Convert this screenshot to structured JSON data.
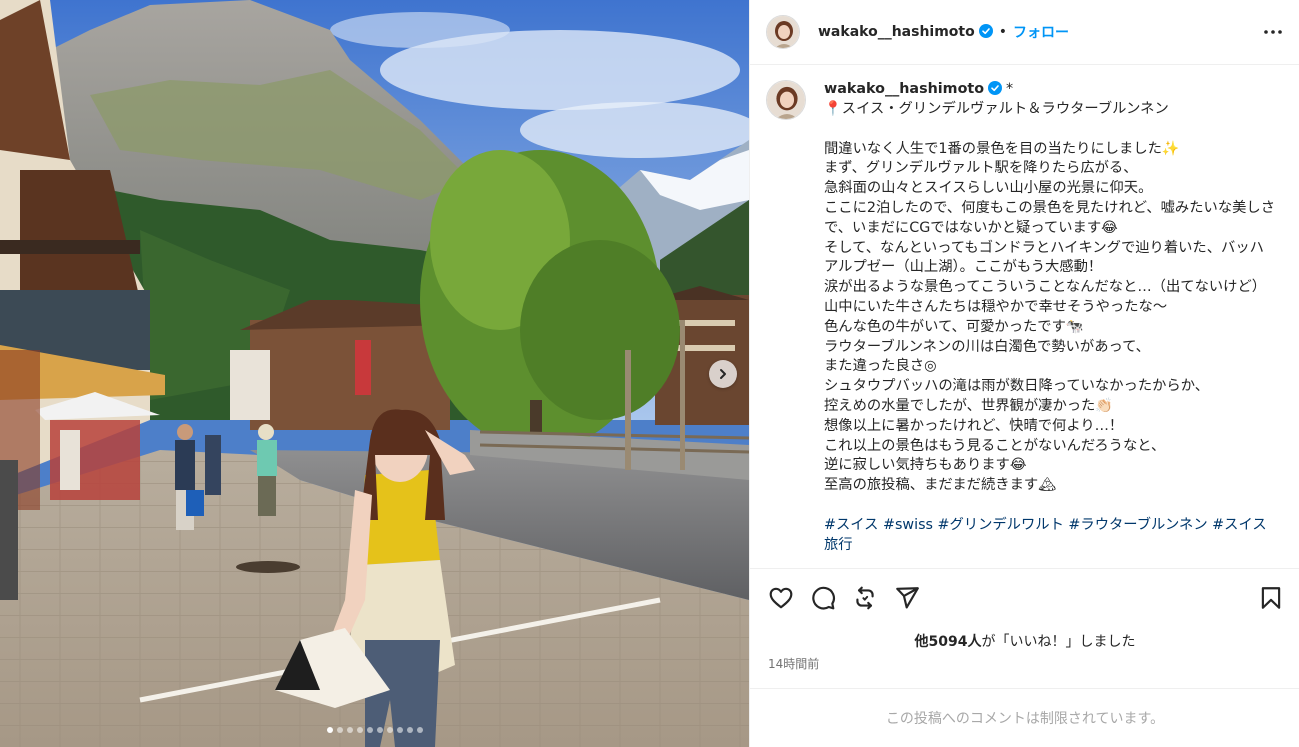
{
  "post": {
    "username": "wakako__hashimoto",
    "follow_label": "フォロー",
    "bullet": "•",
    "asterisk": "*",
    "location_line": "📍スイス・グリンデルヴァルト＆ラウターブルンネン",
    "caption_text": "間違いなく人生で1番の景色を目の当たりにしました✨\nまず、グリンデルヴァルト駅を降りたら広がる、\n急斜面の山々とスイスらしい山小屋の光景に仰天。\nここに2泊したので、何度もこの景色を見たけれど、嘘みたいな美しさで、いまだにCGではないかと疑っています😂\nそして、なんといってもゴンドラとハイキングで辿り着いた、バッハアルプゼー（山上湖）。ここがもう大感動！\n涙が出るような景色ってこういうことなんだなと…（出てないけど）\n山中にいた牛さんたちは穏やかで幸せそうやったな〜\n色んな色の牛がいて、可愛かったです🐄\nラウターブルンネンの川は白濁色で勢いがあって、\nまた違った良さ◎\nシュタウプバッハの滝は雨が数日降っていなかったからか、\n控えめの水量でしたが、世界観が凄かった👏🏻\n想像以上に暑かったけれど、快晴で何より…！\nこれ以上の景色はもう見ることがないんだろうなと、\n逆に寂しい気持ちもあります😂\n至高の旅投稿、まだまだ続きます🏔",
    "hashtags": "#スイス #swiss #グリンデルワルト #ラウターブルンネン #スイス旅行",
    "likes_prefix": "他5094人",
    "likes_suffix": "が「いいね！」しました",
    "timestamp": "14時間前",
    "comments_restricted": "この投稿へのコメントは制限されています。"
  },
  "carousel": {
    "count": 10,
    "active_index": 0
  },
  "icons": [
    "verified-badge-icon",
    "more-options-icon",
    "heart-icon",
    "comment-icon",
    "repost-icon",
    "share-icon",
    "bookmark-icon",
    "chevron-right-icon"
  ],
  "colors": {
    "follow": "#0095f6",
    "hashtag": "#00376b",
    "verified": "#0095f6",
    "muted": "#737373"
  }
}
